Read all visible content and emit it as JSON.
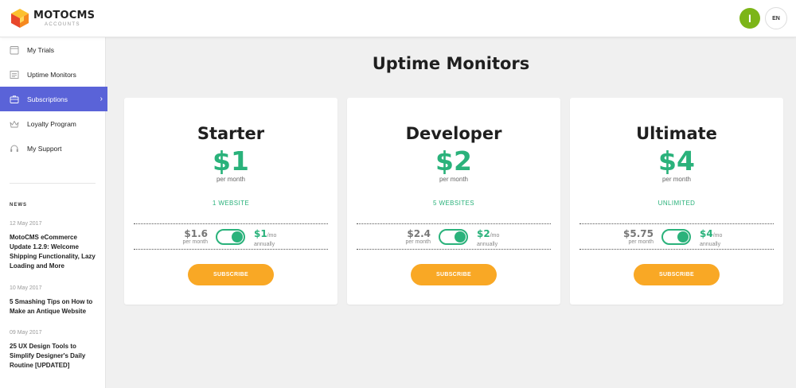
{
  "brand": {
    "name": "MOTOCMS",
    "sub": "ACCOUNTS"
  },
  "header": {
    "avatar_letter": "I",
    "avatar_color": "#7cb518",
    "lang": "EN"
  },
  "sidebar": {
    "items": [
      {
        "label": "My Trials",
        "icon": "calendar-icon"
      },
      {
        "label": "Uptime Monitors",
        "icon": "monitor-icon"
      },
      {
        "label": "Subscriptions",
        "icon": "briefcase-icon",
        "active": true
      },
      {
        "label": "Loyalty Program",
        "icon": "crown-icon"
      },
      {
        "label": "My Support",
        "icon": "headset-icon"
      }
    ],
    "active_color": "#5a63d8"
  },
  "news": {
    "title": "NEWS",
    "items": [
      {
        "date": "12 May 2017",
        "headline": "MotoCMS eCommerce Update 1.2.9: Welcome Shipping Functionality, Lazy Loading and More"
      },
      {
        "date": "10 May 2017",
        "headline": "5 Smashing Tips on How to Make an Antique Website"
      },
      {
        "date": "09 May 2017",
        "headline": "25 UX Design Tools to Simplify Designer's Daily Routine [UPDATED]"
      }
    ]
  },
  "main": {
    "title": "Uptime Monitors",
    "plans": [
      {
        "name": "Starter",
        "price": "$1",
        "period": "per month",
        "feature": "1 WEBSITE",
        "monthly_price": "$1.6",
        "monthly_label": "per month",
        "annual_price": "$1",
        "annual_unit": "/mo",
        "annual_label": "annually",
        "button": "SUBSCRIBE"
      },
      {
        "name": "Developer",
        "price": "$2",
        "period": "per month",
        "feature": "5 WEBSITES",
        "monthly_price": "$2.4",
        "monthly_label": "per month",
        "annual_price": "$2",
        "annual_unit": "/mo",
        "annual_label": "annually",
        "button": "SUBSCRIBE"
      },
      {
        "name": "Ultimate",
        "price": "$4",
        "period": "per month",
        "feature": "UNLIMITED",
        "monthly_price": "$5.75",
        "monthly_label": "per month",
        "annual_price": "$4",
        "annual_unit": "/mo",
        "annual_label": "annually",
        "button": "SUBSCRIBE"
      }
    ],
    "accent_color": "#2ab27b",
    "button_color": "#f9a825"
  }
}
